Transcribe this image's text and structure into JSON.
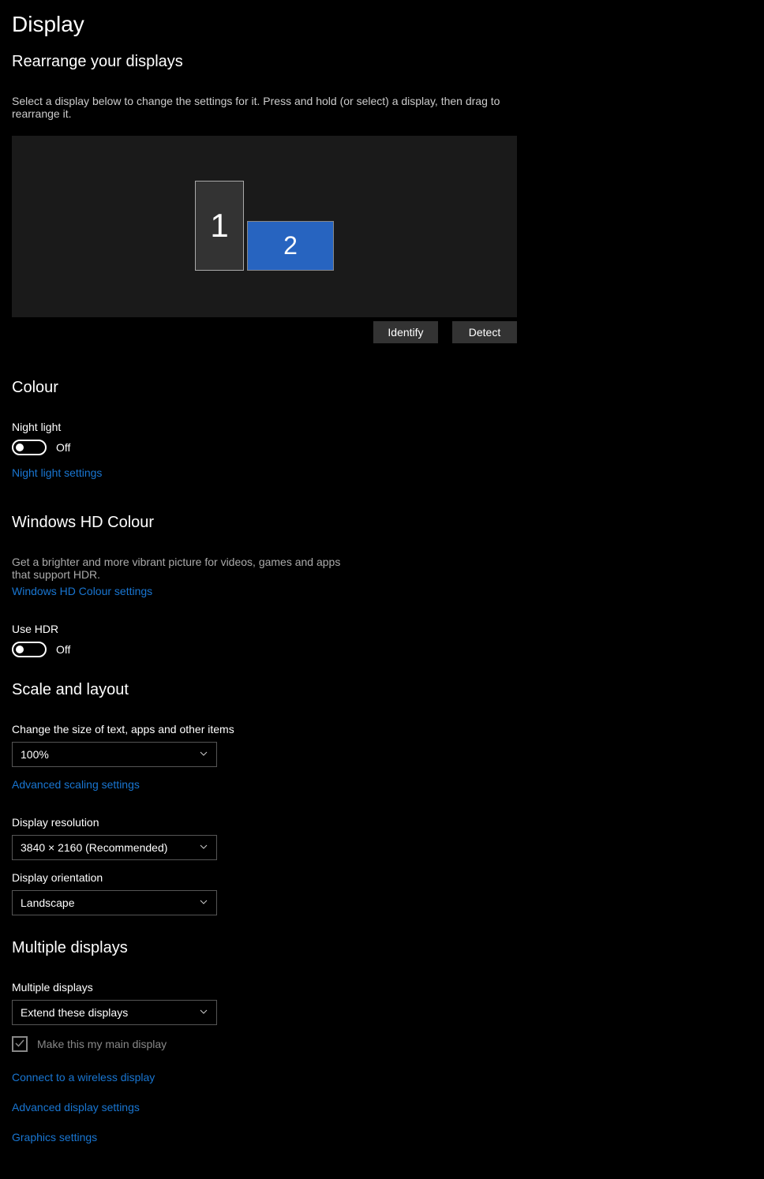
{
  "pageTitle": "Display",
  "rearrange": {
    "title": "Rearrange your displays",
    "desc": "Select a display below to change the settings for it. Press and hold (or select) a display, then drag to rearrange it.",
    "monitor1": "1",
    "monitor2": "2",
    "identify": "Identify",
    "detect": "Detect"
  },
  "colour": {
    "title": "Colour",
    "nightLightLabel": "Night light",
    "nightLightState": "Off",
    "nightLightSettings": "Night light settings"
  },
  "hd": {
    "title": "Windows HD Colour",
    "desc": "Get a brighter and more vibrant picture for videos, games and apps that support HDR.",
    "settingsLink": "Windows HD Colour settings",
    "useHdrLabel": "Use HDR",
    "useHdrState": "Off"
  },
  "scale": {
    "title": "Scale and layout",
    "changeSizeLabel": "Change the size of text, apps and other items",
    "scaleValue": "100%",
    "advancedScaling": "Advanced scaling settings",
    "resolutionLabel": "Display resolution",
    "resolutionValue": "3840 × 2160 (Recommended)",
    "orientationLabel": "Display orientation",
    "orientationValue": "Landscape"
  },
  "multiple": {
    "title": "Multiple displays",
    "label": "Multiple displays",
    "value": "Extend these displays",
    "mainDisplay": "Make this my main display",
    "connectWireless": "Connect to a wireless display",
    "advancedDisplay": "Advanced display settings",
    "graphics": "Graphics settings"
  }
}
